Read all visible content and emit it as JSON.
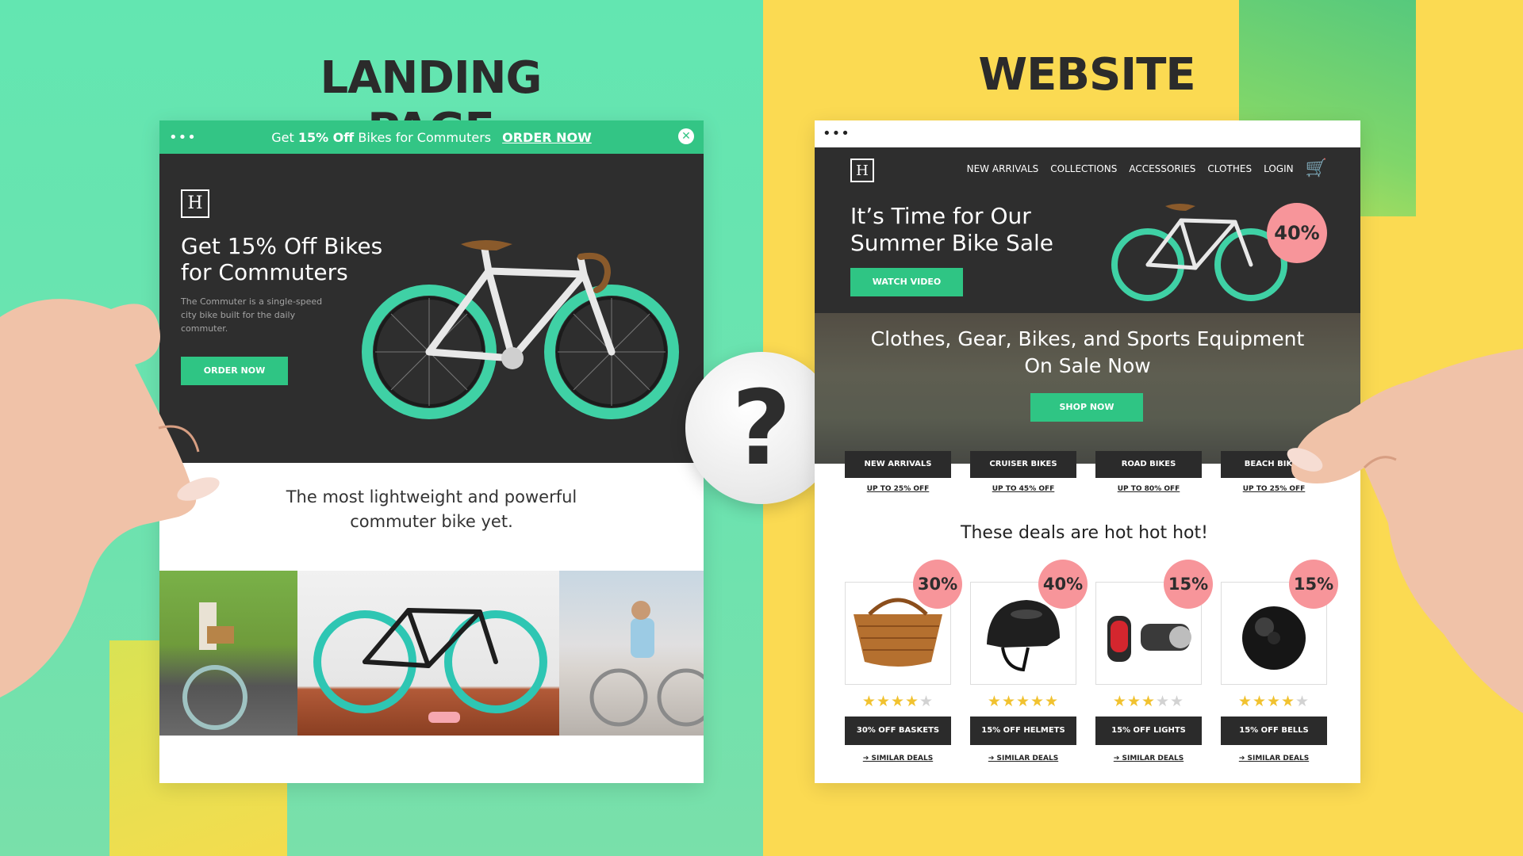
{
  "headings": {
    "left": "LANDING PAGE",
    "right": "WEBSITE"
  },
  "center_symbol": "?",
  "landing_page": {
    "topbar": {
      "dots": "•••",
      "promo_prefix": "Get ",
      "promo_bold": "15% Off",
      "promo_suffix": " Bikes for Commuters",
      "promo_link": "ORDER NOW",
      "close_icon": "✕"
    },
    "hero": {
      "logo": "H",
      "title": "Get 15% Off Bikes for Commuters",
      "description": "The Commuter is a single-speed city bike built for the daily commuter.",
      "button": "ORDER NOW"
    },
    "tagline": "The most lightweight and powerful commuter bike yet."
  },
  "website": {
    "browser_dots": "•••",
    "logo": "H",
    "nav": [
      "NEW ARRIVALS",
      "COLLECTIONS",
      "ACCESSORIES",
      "CLOTHES",
      "LOGIN"
    ],
    "cart_icon": "🛒",
    "hero": {
      "title": "It’s Time for Our Summer Bike Sale",
      "button": "WATCH VIDEO",
      "badge": "40%"
    },
    "banner": {
      "title": "Clothes, Gear, Bikes, and Sports Equipment On Sale Now",
      "button": "SHOP NOW"
    },
    "categories": [
      {
        "label": "NEW ARRIVALS",
        "sub": "UP TO 25% OFF"
      },
      {
        "label": "CRUISER BIKES",
        "sub": "UP TO 45% OFF"
      },
      {
        "label": "ROAD BIKES",
        "sub": "UP TO 80% OFF"
      },
      {
        "label": "BEACH BIKES",
        "sub": "UP TO 25% OFF"
      }
    ],
    "deals_title": "These deals are hot hot hot!",
    "products": [
      {
        "badge": "30%",
        "rating": 4,
        "button": "30% OFF BASKETS",
        "link": "➔ SIMILAR DEALS",
        "icon": "basket-icon"
      },
      {
        "badge": "40%",
        "rating": 5,
        "button": "15% OFF HELMETS",
        "link": "➔ SIMILAR DEALS",
        "icon": "helmet-icon"
      },
      {
        "badge": "15%",
        "rating": 3,
        "button": "15% OFF LIGHTS",
        "link": "➔ SIMILAR DEALS",
        "icon": "lights-icon"
      },
      {
        "badge": "15%",
        "rating": 4,
        "button": "15% OFF BELLS",
        "link": "➔ SIMILAR DEALS",
        "icon": "bell-icon"
      }
    ]
  },
  "colors": {
    "green_bg": "#63e6b1",
    "yellow_bg": "#fbda52",
    "accent_green": "#2fc584",
    "dark_panel": "#2e2e2e",
    "badge_pink": "#f7959a",
    "star_gold": "#f1c22f"
  }
}
